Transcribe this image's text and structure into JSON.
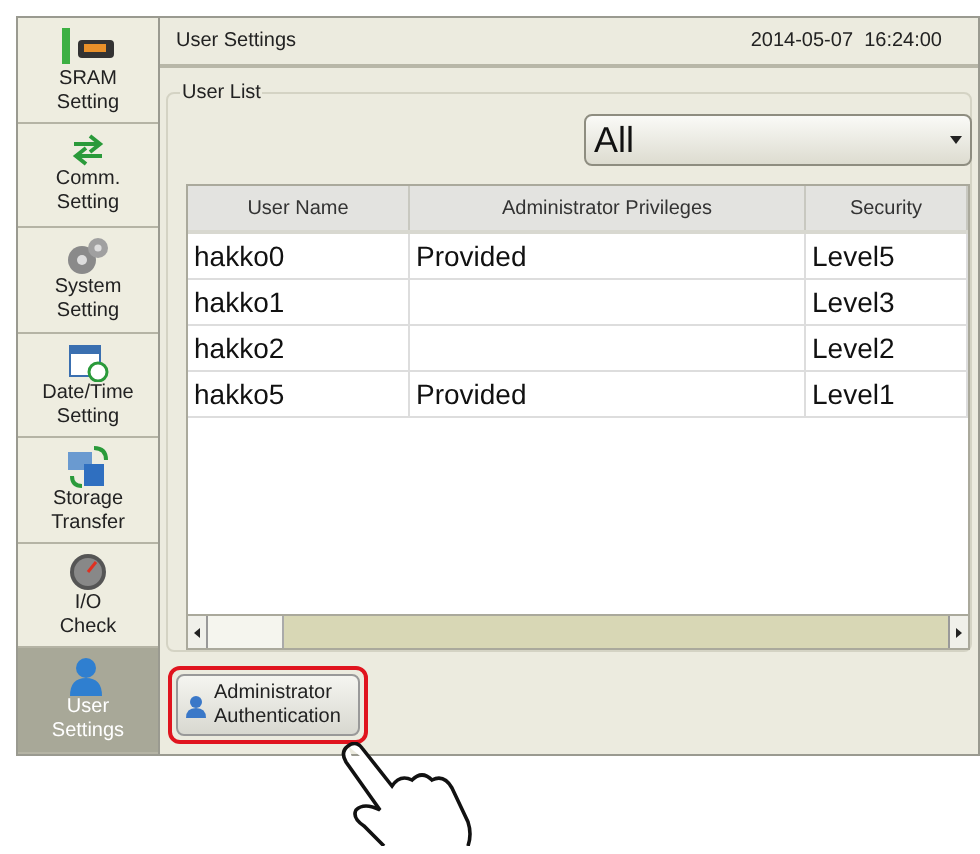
{
  "sidebar": {
    "items": [
      {
        "label": "SRAM\nSetting",
        "selected": false
      },
      {
        "label": "Comm.\nSetting",
        "selected": false
      },
      {
        "label": "System\nSetting",
        "selected": false
      },
      {
        "label": "Date/Time\nSetting",
        "selected": false
      },
      {
        "label": "Storage\nTransfer",
        "selected": false
      },
      {
        "label": "I/O\nCheck",
        "selected": false
      },
      {
        "label": "User\nSettings",
        "selected": true
      }
    ]
  },
  "header": {
    "title": "User Settings",
    "datetime": "2014-05-07  16:24:00"
  },
  "user_list": {
    "title": "User List",
    "filter": {
      "value": "All"
    },
    "table": {
      "columns": [
        "User Name",
        "Administrator Privileges",
        "Security"
      ],
      "rows": [
        [
          "hakko0",
          "Provided",
          "Level5"
        ],
        [
          "hakko1",
          "",
          "Level3"
        ],
        [
          "hakko2",
          "",
          "Level2"
        ],
        [
          "hakko5",
          "Provided",
          "Level1"
        ]
      ]
    }
  },
  "admin_button": {
    "label": "Administrator\nAuthentication",
    "highlighted": true
  }
}
